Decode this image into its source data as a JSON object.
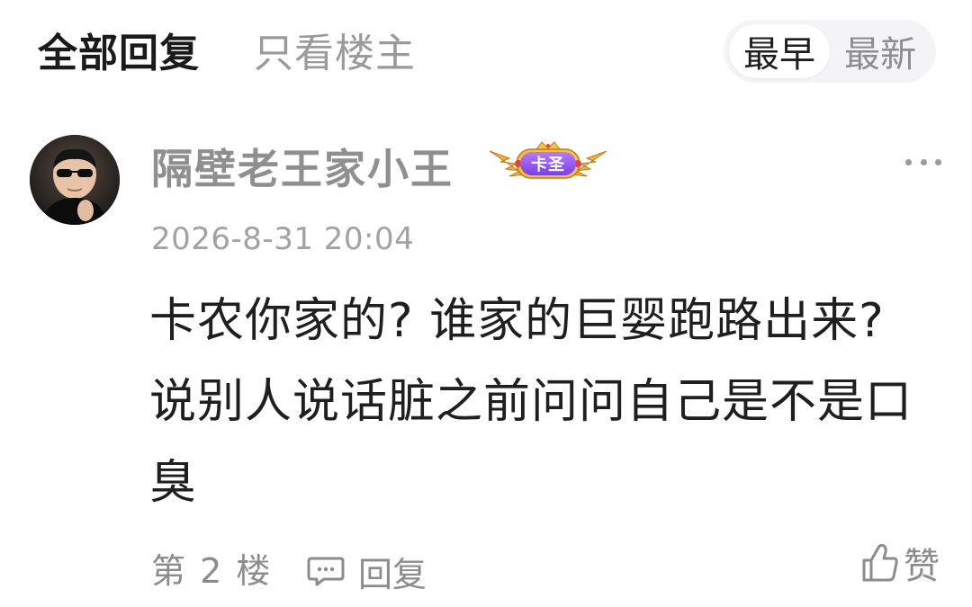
{
  "tabs": {
    "all_replies": "全部回复",
    "op_only": "只看楼主"
  },
  "sort": {
    "earliest": "最早",
    "latest": "最新"
  },
  "post": {
    "username": "隔壁老王家小王",
    "badge_text": "卡圣",
    "timestamp": "2026-8-31 20:04",
    "content": "卡农你家的? 谁家的巨婴跑路出来? 说别人说话脏之前问问自己是不是口臭",
    "floor": "第 2 楼",
    "reply_label": "回复",
    "like_label": "赞"
  },
  "icons": {
    "more": "more-dots-icon",
    "reply": "comment-bubble-icon",
    "like": "thumbs-up-icon",
    "badge": "winged-crown-badge-icon"
  },
  "colors": {
    "badge_purple": "#8a4ff0",
    "badge_gold": "#e0a22a"
  }
}
